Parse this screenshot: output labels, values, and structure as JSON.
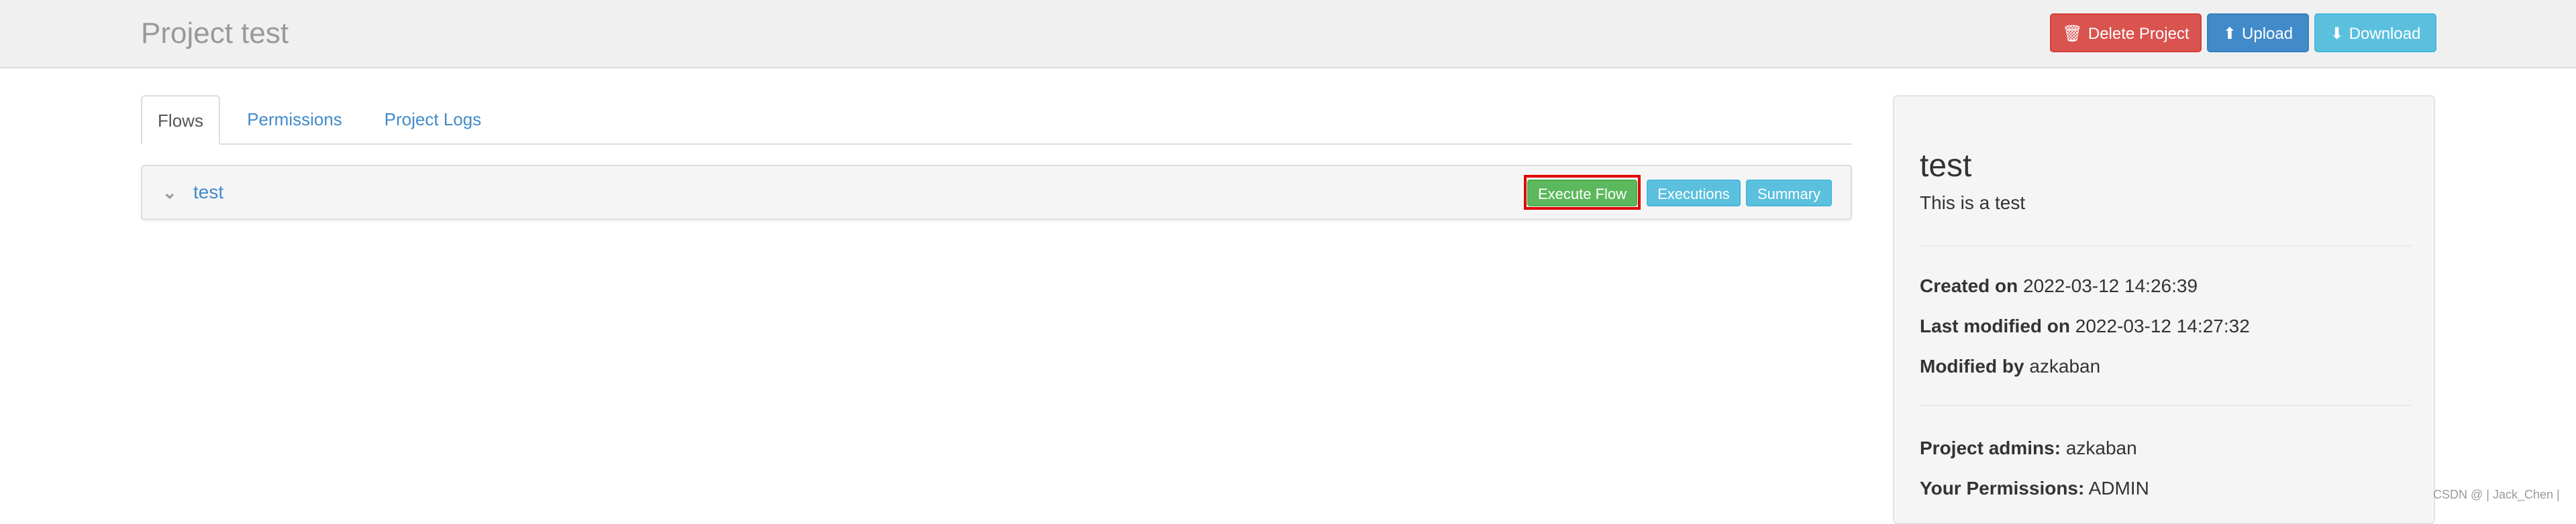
{
  "header": {
    "title": "Project test",
    "buttons": {
      "delete": {
        "label": "Delete Project",
        "icon": "trash-icon"
      },
      "upload": {
        "label": "Upload",
        "icon": "circle-arrow-up-icon"
      },
      "download": {
        "label": "Download",
        "icon": "circle-arrow-down-icon"
      }
    }
  },
  "tabs": [
    {
      "label": "Flows",
      "active": true
    },
    {
      "label": "Permissions",
      "active": false
    },
    {
      "label": "Project Logs",
      "active": false
    }
  ],
  "flows": [
    {
      "name": "test",
      "buttons": {
        "execute": "Execute Flow",
        "executions": "Executions",
        "summary": "Summary"
      }
    }
  ],
  "project": {
    "name": "test",
    "description": "This is a test",
    "created_on": {
      "label": "Created on",
      "value": "2022-03-12 14:26:39"
    },
    "last_modified_on": {
      "label": "Last modified on",
      "value": "2022-03-12 14:27:32"
    },
    "modified_by": {
      "label": "Modified by",
      "value": "azkaban"
    },
    "project_admins": {
      "label": "Project admins:",
      "value": "azkaban"
    },
    "your_permissions": {
      "label": "Your Permissions:",
      "value": "ADMIN"
    }
  },
  "watermark": "CSDN @ | Jack_Chen |",
  "colors": {
    "danger": "#d9534f",
    "primary": "#428bca",
    "info": "#5bc0de",
    "success": "#5cb85c",
    "highlight": "#e00000"
  }
}
